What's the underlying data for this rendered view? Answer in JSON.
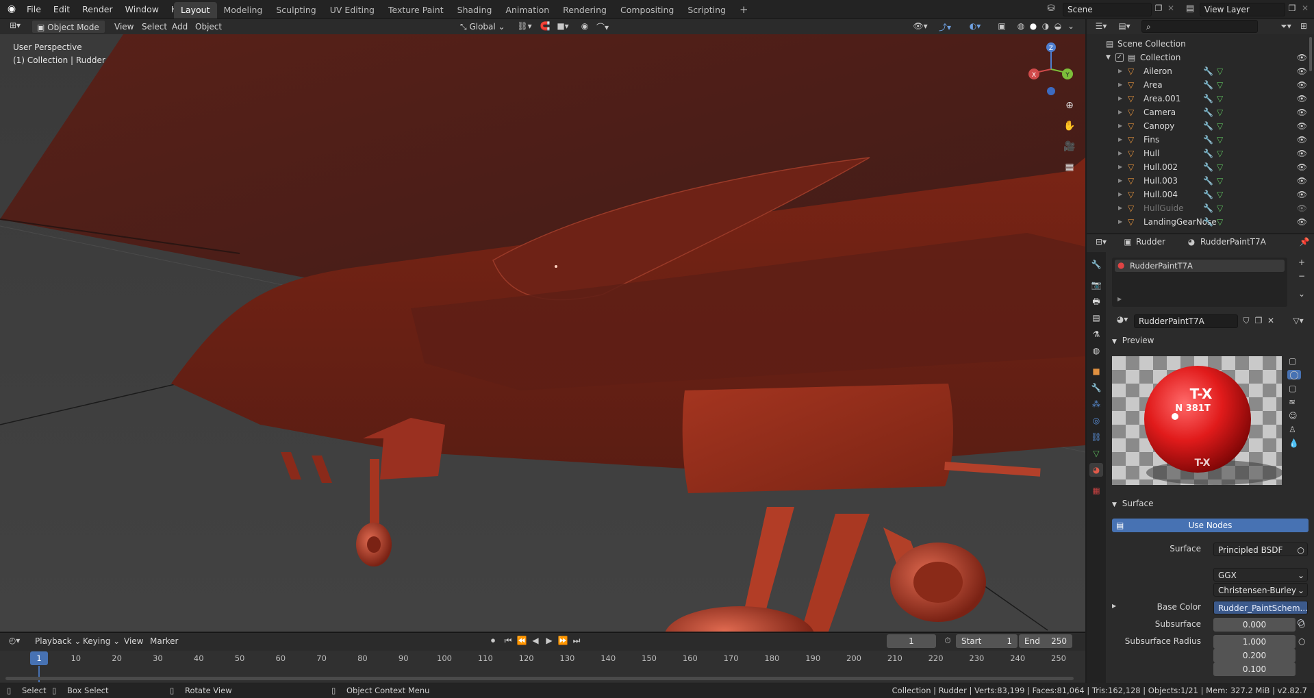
{
  "topbar": {
    "menus": [
      "File",
      "Edit",
      "Render",
      "Window",
      "Help"
    ],
    "workspaces": [
      "Layout",
      "Modeling",
      "Sculpting",
      "UV Editing",
      "Texture Paint",
      "Shading",
      "Animation",
      "Rendering",
      "Compositing",
      "Scripting"
    ],
    "add_tab": "+",
    "scene": "Scene",
    "view_layer": "View Layer"
  },
  "viewport_header": {
    "mode": "Object Mode",
    "menus": [
      "View",
      "Select",
      "Add",
      "Object"
    ],
    "orientation": "Global"
  },
  "viewport": {
    "perspective": "User Perspective",
    "collection": "(1) Collection | Rudder",
    "gizmo": {
      "z": "Z",
      "x": "X",
      "y": "Y"
    }
  },
  "outliner": {
    "search_placeholder": "",
    "scene_collection": "Scene Collection",
    "collection": "Collection",
    "items": [
      {
        "name": "Aileron"
      },
      {
        "name": "Area"
      },
      {
        "name": "Area.001"
      },
      {
        "name": "Camera"
      },
      {
        "name": "Canopy"
      },
      {
        "name": "Fins"
      },
      {
        "name": "Hull"
      },
      {
        "name": "Hull.002"
      },
      {
        "name": "Hull.003"
      },
      {
        "name": "Hull.004"
      },
      {
        "name": "HullGuide"
      },
      {
        "name": "LandingGearNose"
      }
    ]
  },
  "properties": {
    "object": "Rudder",
    "material": "RudderPaintT7A",
    "slot": "RudderPaintT7A",
    "material_field": "RudderPaintT7A",
    "preview_label": "Preview",
    "preview_text": {
      "line1": "T-X",
      "line2": "N 381T",
      "line3": "T-X"
    },
    "surface_label": "Surface",
    "use_nodes": "Use Nodes",
    "surface_row": {
      "label": "Surface",
      "value": "Principled BSDF"
    },
    "distribution": "GGX",
    "subsurface_method": "Christensen-Burley",
    "base_color": {
      "label": "Base Color",
      "value": "Rudder_PaintSchem..."
    },
    "subsurface": {
      "label": "Subsurface",
      "value": "0.000"
    },
    "subsurface_radius": {
      "label": "Subsurface Radius",
      "values": [
        "1.000",
        "0.200",
        "0.100"
      ]
    }
  },
  "timeline": {
    "menus": [
      "Playback",
      "Keying",
      "View",
      "Marker"
    ],
    "current_frame": "1",
    "start_label": "Start",
    "start": "1",
    "end_label": "End",
    "end": "250",
    "ticks": [
      "1",
      "10",
      "20",
      "30",
      "40",
      "50",
      "60",
      "70",
      "80",
      "90",
      "100",
      "110",
      "120",
      "130",
      "140",
      "150",
      "160",
      "170",
      "180",
      "190",
      "200",
      "210",
      "220",
      "230",
      "240",
      "250"
    ]
  },
  "statusbar": {
    "select": "Select",
    "box_select": "Box Select",
    "rotate_view": "Rotate View",
    "context_menu": "Object Context Menu",
    "stats": "Collection | Rudder | Verts:83,199 | Faces:81,064 | Tris:162,128 | Objects:1/21 | Mem: 327.2 MiB | v2.82.7"
  },
  "colors": {
    "accent": "#4772b3",
    "material_red": "#8c2414"
  }
}
